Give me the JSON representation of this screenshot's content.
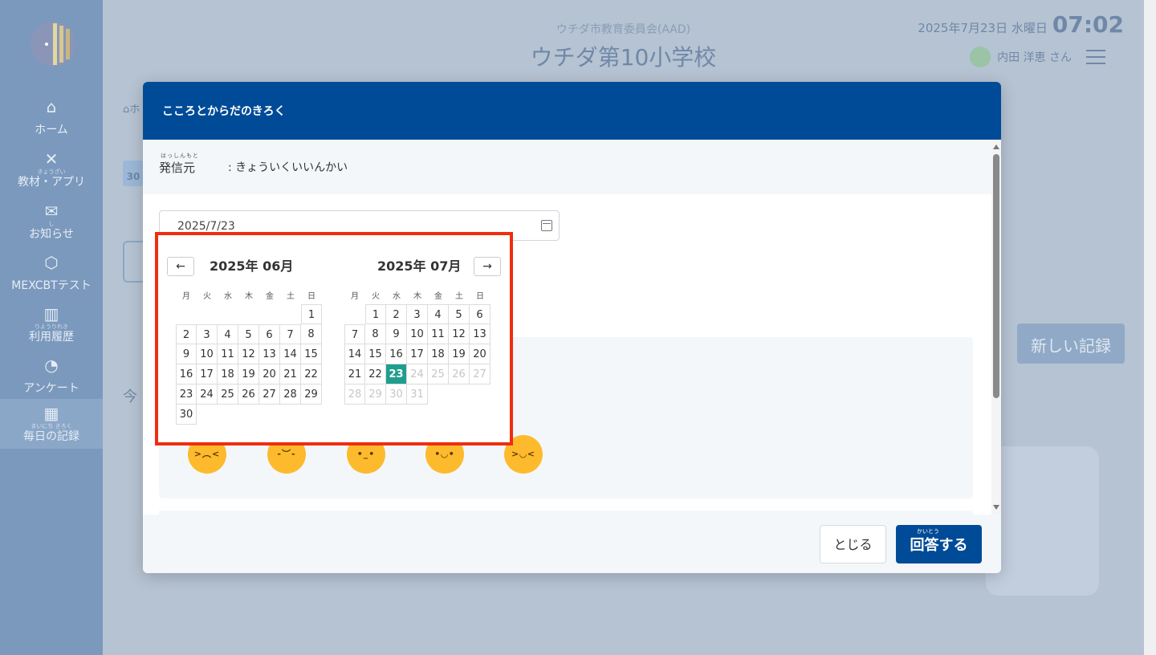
{
  "sidebar": {
    "items": [
      {
        "icon": "home-icon",
        "ruby": "",
        "label": "ホーム"
      },
      {
        "icon": "tools-icon",
        "ruby": "きょうざい",
        "label": "教材・アプリ"
      },
      {
        "icon": "mail-icon",
        "ruby": "し",
        "label": "お知らせ"
      },
      {
        "icon": "cube-icon",
        "ruby": "",
        "label": "MEXCBTテスト"
      },
      {
        "icon": "bar-chart-icon",
        "ruby": "りようりれき",
        "label": "利用履歴"
      },
      {
        "icon": "pie-chart-icon",
        "ruby": "",
        "label": "アンケート"
      },
      {
        "icon": "calendar-icon",
        "ruby": "まいにち きろく",
        "label": "毎日の記録"
      }
    ]
  },
  "header": {
    "org": "ウチダ市教育委員会(AAD)",
    "school": "ウチダ第10小学校",
    "date": "2025年7月23日 水曜日",
    "time": "07:02",
    "user": "内田 洋恵 さん"
  },
  "background": {
    "new_record_button": "新しい記録"
  },
  "modal": {
    "title": "こころとからだのきろく",
    "sender_label": "発信元",
    "sender_ruby": "はっしんもと",
    "sender_value": ": きょういくいいんかい",
    "date_value": "2025/7/23",
    "close_button": "とじる",
    "answer_button": "回答する",
    "answer_ruby": "かいとう"
  },
  "datepicker": {
    "prev_label": "←",
    "next_label": "→",
    "weekdays": [
      "月",
      "火",
      "水",
      "木",
      "金",
      "土",
      "日"
    ],
    "months": [
      {
        "title": "2025年 06月",
        "lead": 6,
        "days": 30,
        "selected": null,
        "disabled_from": null
      },
      {
        "title": "2025年 07月",
        "lead": 1,
        "days": 31,
        "selected": 23,
        "disabled_from": 24
      }
    ]
  },
  "colors": {
    "header": "#004b97",
    "selected_day": "#1f9e8f",
    "highlight_border": "#ef2d10"
  }
}
